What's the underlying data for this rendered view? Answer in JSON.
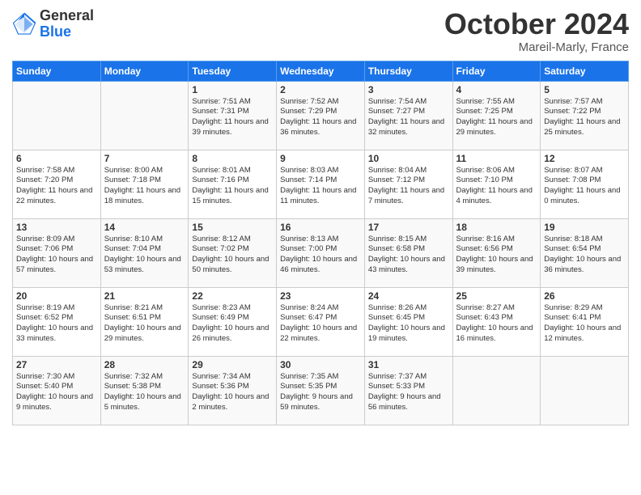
{
  "logo": {
    "general": "General",
    "blue": "Blue"
  },
  "title": "October 2024",
  "subtitle": "Mareil-Marly, France",
  "days_header": [
    "Sunday",
    "Monday",
    "Tuesday",
    "Wednesday",
    "Thursday",
    "Friday",
    "Saturday"
  ],
  "weeks": [
    [
      {
        "day": "",
        "content": ""
      },
      {
        "day": "",
        "content": ""
      },
      {
        "day": "1",
        "content": "Sunrise: 7:51 AM\nSunset: 7:31 PM\nDaylight: 11 hours and 39 minutes."
      },
      {
        "day": "2",
        "content": "Sunrise: 7:52 AM\nSunset: 7:29 PM\nDaylight: 11 hours and 36 minutes."
      },
      {
        "day": "3",
        "content": "Sunrise: 7:54 AM\nSunset: 7:27 PM\nDaylight: 11 hours and 32 minutes."
      },
      {
        "day": "4",
        "content": "Sunrise: 7:55 AM\nSunset: 7:25 PM\nDaylight: 11 hours and 29 minutes."
      },
      {
        "day": "5",
        "content": "Sunrise: 7:57 AM\nSunset: 7:22 PM\nDaylight: 11 hours and 25 minutes."
      }
    ],
    [
      {
        "day": "6",
        "content": "Sunrise: 7:58 AM\nSunset: 7:20 PM\nDaylight: 11 hours and 22 minutes."
      },
      {
        "day": "7",
        "content": "Sunrise: 8:00 AM\nSunset: 7:18 PM\nDaylight: 11 hours and 18 minutes."
      },
      {
        "day": "8",
        "content": "Sunrise: 8:01 AM\nSunset: 7:16 PM\nDaylight: 11 hours and 15 minutes."
      },
      {
        "day": "9",
        "content": "Sunrise: 8:03 AM\nSunset: 7:14 PM\nDaylight: 11 hours and 11 minutes."
      },
      {
        "day": "10",
        "content": "Sunrise: 8:04 AM\nSunset: 7:12 PM\nDaylight: 11 hours and 7 minutes."
      },
      {
        "day": "11",
        "content": "Sunrise: 8:06 AM\nSunset: 7:10 PM\nDaylight: 11 hours and 4 minutes."
      },
      {
        "day": "12",
        "content": "Sunrise: 8:07 AM\nSunset: 7:08 PM\nDaylight: 11 hours and 0 minutes."
      }
    ],
    [
      {
        "day": "13",
        "content": "Sunrise: 8:09 AM\nSunset: 7:06 PM\nDaylight: 10 hours and 57 minutes."
      },
      {
        "day": "14",
        "content": "Sunrise: 8:10 AM\nSunset: 7:04 PM\nDaylight: 10 hours and 53 minutes."
      },
      {
        "day": "15",
        "content": "Sunrise: 8:12 AM\nSunset: 7:02 PM\nDaylight: 10 hours and 50 minutes."
      },
      {
        "day": "16",
        "content": "Sunrise: 8:13 AM\nSunset: 7:00 PM\nDaylight: 10 hours and 46 minutes."
      },
      {
        "day": "17",
        "content": "Sunrise: 8:15 AM\nSunset: 6:58 PM\nDaylight: 10 hours and 43 minutes."
      },
      {
        "day": "18",
        "content": "Sunrise: 8:16 AM\nSunset: 6:56 PM\nDaylight: 10 hours and 39 minutes."
      },
      {
        "day": "19",
        "content": "Sunrise: 8:18 AM\nSunset: 6:54 PM\nDaylight: 10 hours and 36 minutes."
      }
    ],
    [
      {
        "day": "20",
        "content": "Sunrise: 8:19 AM\nSunset: 6:52 PM\nDaylight: 10 hours and 33 minutes."
      },
      {
        "day": "21",
        "content": "Sunrise: 8:21 AM\nSunset: 6:51 PM\nDaylight: 10 hours and 29 minutes."
      },
      {
        "day": "22",
        "content": "Sunrise: 8:23 AM\nSunset: 6:49 PM\nDaylight: 10 hours and 26 minutes."
      },
      {
        "day": "23",
        "content": "Sunrise: 8:24 AM\nSunset: 6:47 PM\nDaylight: 10 hours and 22 minutes."
      },
      {
        "day": "24",
        "content": "Sunrise: 8:26 AM\nSunset: 6:45 PM\nDaylight: 10 hours and 19 minutes."
      },
      {
        "day": "25",
        "content": "Sunrise: 8:27 AM\nSunset: 6:43 PM\nDaylight: 10 hours and 16 minutes."
      },
      {
        "day": "26",
        "content": "Sunrise: 8:29 AM\nSunset: 6:41 PM\nDaylight: 10 hours and 12 minutes."
      }
    ],
    [
      {
        "day": "27",
        "content": "Sunrise: 7:30 AM\nSunset: 5:40 PM\nDaylight: 10 hours and 9 minutes."
      },
      {
        "day": "28",
        "content": "Sunrise: 7:32 AM\nSunset: 5:38 PM\nDaylight: 10 hours and 5 minutes."
      },
      {
        "day": "29",
        "content": "Sunrise: 7:34 AM\nSunset: 5:36 PM\nDaylight: 10 hours and 2 minutes."
      },
      {
        "day": "30",
        "content": "Sunrise: 7:35 AM\nSunset: 5:35 PM\nDaylight: 9 hours and 59 minutes."
      },
      {
        "day": "31",
        "content": "Sunrise: 7:37 AM\nSunset: 5:33 PM\nDaylight: 9 hours and 56 minutes."
      },
      {
        "day": "",
        "content": ""
      },
      {
        "day": "",
        "content": ""
      }
    ]
  ]
}
